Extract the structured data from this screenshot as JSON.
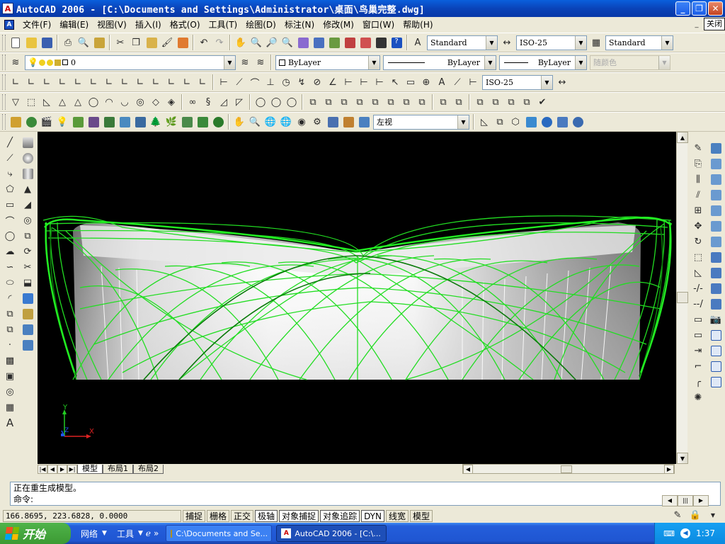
{
  "window": {
    "title": "AutoCAD 2006 - [C:\\Documents and Settings\\Administrator\\桌面\\鸟巢完整.dwg]",
    "controls": {
      "minimize": "_",
      "maximize": "❐",
      "close": "✕"
    }
  },
  "menu": {
    "items": [
      "文件(F)",
      "编辑(E)",
      "视图(V)",
      "插入(I)",
      "格式(O)",
      "工具(T)",
      "绘图(D)",
      "标注(N)",
      "修改(M)",
      "窗口(W)",
      "帮助(H)"
    ],
    "doc_close_tooltip": "关闭"
  },
  "toolbars": {
    "text_style": "Standard",
    "dim_style": "ISO-25",
    "table_style": "Standard",
    "layer": "0",
    "color": "ByLayer",
    "linetype": "ByLayer",
    "lineweight": "ByLayer",
    "plot_style": "随颜色",
    "dim_style_2": "ISO-25",
    "view": "左视"
  },
  "ucs": {
    "x": "X",
    "y": "Y",
    "z": "Z"
  },
  "tabs": {
    "model": "模型",
    "layout1": "布局1",
    "layout2": "布局2"
  },
  "command": {
    "history": "正在重生成模型。",
    "prompt": "命令:"
  },
  "status": {
    "coords": "166.8695, 223.6828, 0.0000",
    "buttons": [
      "捕捉",
      "栅格",
      "正交",
      "极轴",
      "对象捕捉",
      "对象追踪",
      "DYN",
      "线宽",
      "模型"
    ]
  },
  "taskbar": {
    "start": "开始",
    "links": [
      "网络",
      "工具"
    ],
    "tasks": [
      "C:\\Documents and Se...",
      "AutoCAD 2006 - [C:\\..."
    ],
    "clock": "1:37"
  },
  "colors": {
    "wire_green": "#22dd22",
    "drawing_bg": "#000000",
    "title_blue": "#0a43b8"
  }
}
